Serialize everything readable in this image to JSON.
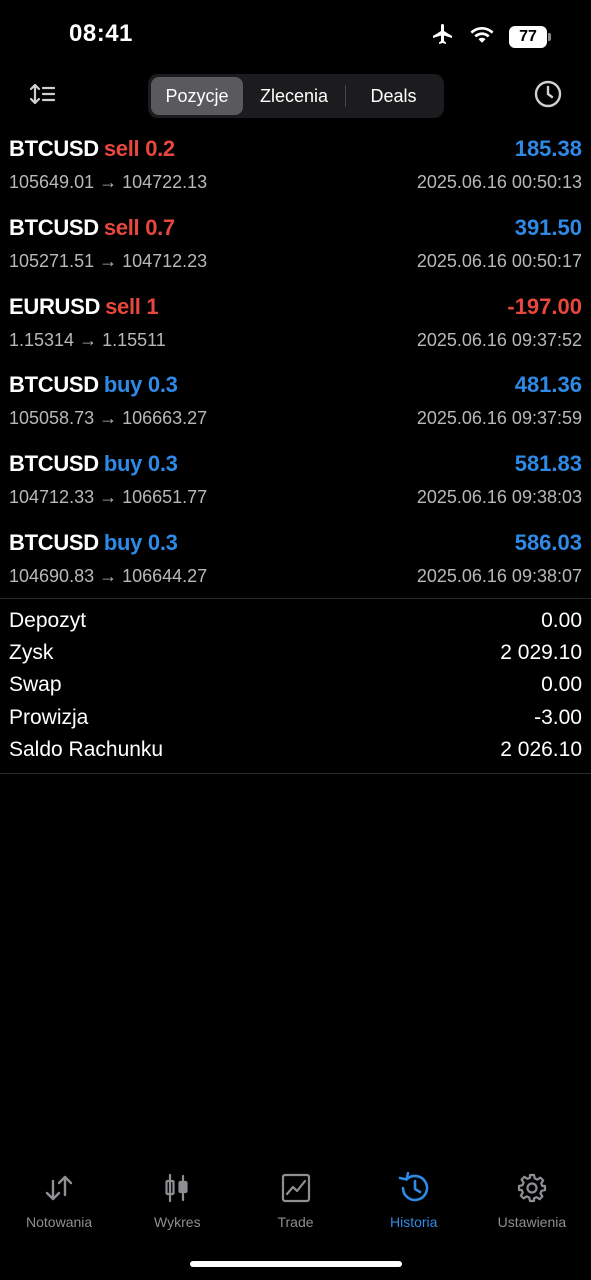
{
  "status_bar": {
    "time": "08:41",
    "battery": "77",
    "icons": [
      "airplane-icon",
      "wifi-icon",
      "battery-icon"
    ]
  },
  "header": {
    "tabs": [
      {
        "label": "Pozycje",
        "active": true
      },
      {
        "label": "Zlecenia",
        "active": false
      },
      {
        "label": "Deals",
        "active": false
      }
    ],
    "left_icon": "sort-icon",
    "right_icon": "clock-icon"
  },
  "deals": [
    {
      "symbol": "BTCUSD",
      "side": "sell",
      "volume": "0.2",
      "prices": "105649.01 → 104722.13",
      "profit": "185.38",
      "time": "2025.06.16 00:50:13"
    },
    {
      "symbol": "BTCUSD",
      "side": "sell",
      "volume": "0.7",
      "prices": "105271.51 → 104712.23",
      "profit": "391.50",
      "time": "2025.06.16 00:50:17"
    },
    {
      "symbol": "EURUSD",
      "side": "sell",
      "volume": "1",
      "prices": "1.15314 → 1.15511",
      "profit": "-197.00",
      "time": "2025.06.16 09:37:52"
    },
    {
      "symbol": "BTCUSD",
      "side": "buy",
      "volume": "0.3",
      "prices": "105058.73 → 106663.27",
      "profit": "481.36",
      "time": "2025.06.16 09:37:59"
    },
    {
      "symbol": "BTCUSD",
      "side": "buy",
      "volume": "0.3",
      "prices": "104712.33 → 106651.77",
      "profit": "581.83",
      "time": "2025.06.16 09:38:03"
    },
    {
      "symbol": "BTCUSD",
      "side": "buy",
      "volume": "0.3",
      "prices": "104690.83 → 106644.27",
      "profit": "586.03",
      "time": "2025.06.16 09:38:07"
    }
  ],
  "summary": [
    {
      "label": "Depozyt",
      "value": "0.00"
    },
    {
      "label": "Zysk",
      "value": "2 029.10"
    },
    {
      "label": "Swap",
      "value": "0.00"
    },
    {
      "label": "Prowizja",
      "value": "-3.00"
    },
    {
      "label": "Saldo Rachunku",
      "value": "2 026.10"
    }
  ],
  "tabbar": [
    {
      "label": "Notowania",
      "icon": "quotes-arrows-icon",
      "active": false
    },
    {
      "label": "Wykres",
      "icon": "candlestick-icon",
      "active": false
    },
    {
      "label": "Trade",
      "icon": "trade-chart-icon",
      "active": false
    },
    {
      "label": "Historia",
      "icon": "history-icon",
      "active": true
    },
    {
      "label": "Ustawienia",
      "icon": "settings-gear-icon",
      "active": false
    }
  ],
  "colors": {
    "accent": "#2e8ae6",
    "negative": "#e8473e",
    "muted": "#8e8e93"
  }
}
